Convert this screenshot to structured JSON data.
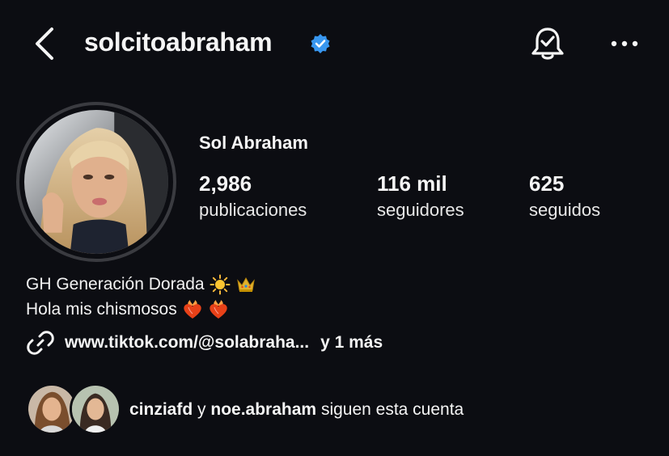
{
  "header": {
    "username": "solcitoabraham",
    "verified": true,
    "icons": [
      "back-icon",
      "verified-badge-icon",
      "notification-bell-icon",
      "more-options-icon"
    ]
  },
  "profile": {
    "display_name": "Sol Abraham",
    "stats": [
      {
        "value": "2,986",
        "label": "publicaciones"
      },
      {
        "value": "116 mil",
        "label": "seguidores"
      },
      {
        "value": "625",
        "label": "seguidos"
      }
    ],
    "bio_lines": [
      {
        "text": "GH Generación Dorada",
        "emojis": [
          "sun-emoji",
          "crown-emoji"
        ]
      },
      {
        "text": "Hola mis chismosos",
        "emojis": [
          "heart-on-fire-emoji",
          "heart-on-fire-emoji"
        ]
      }
    ],
    "link": {
      "text": "www.tiktok.com/@solabraha...",
      "more": "y 1 más"
    }
  },
  "mutual_followers": {
    "user1": "cinziafd",
    "connector": "y",
    "user2": "noe.abraham",
    "suffix": "siguen esta cuenta"
  },
  "colors": {
    "background": "#0c0d12",
    "text": "#f5f5f5",
    "verified_blue": "#3897f0",
    "avatar_ring": "#3a3b40"
  }
}
